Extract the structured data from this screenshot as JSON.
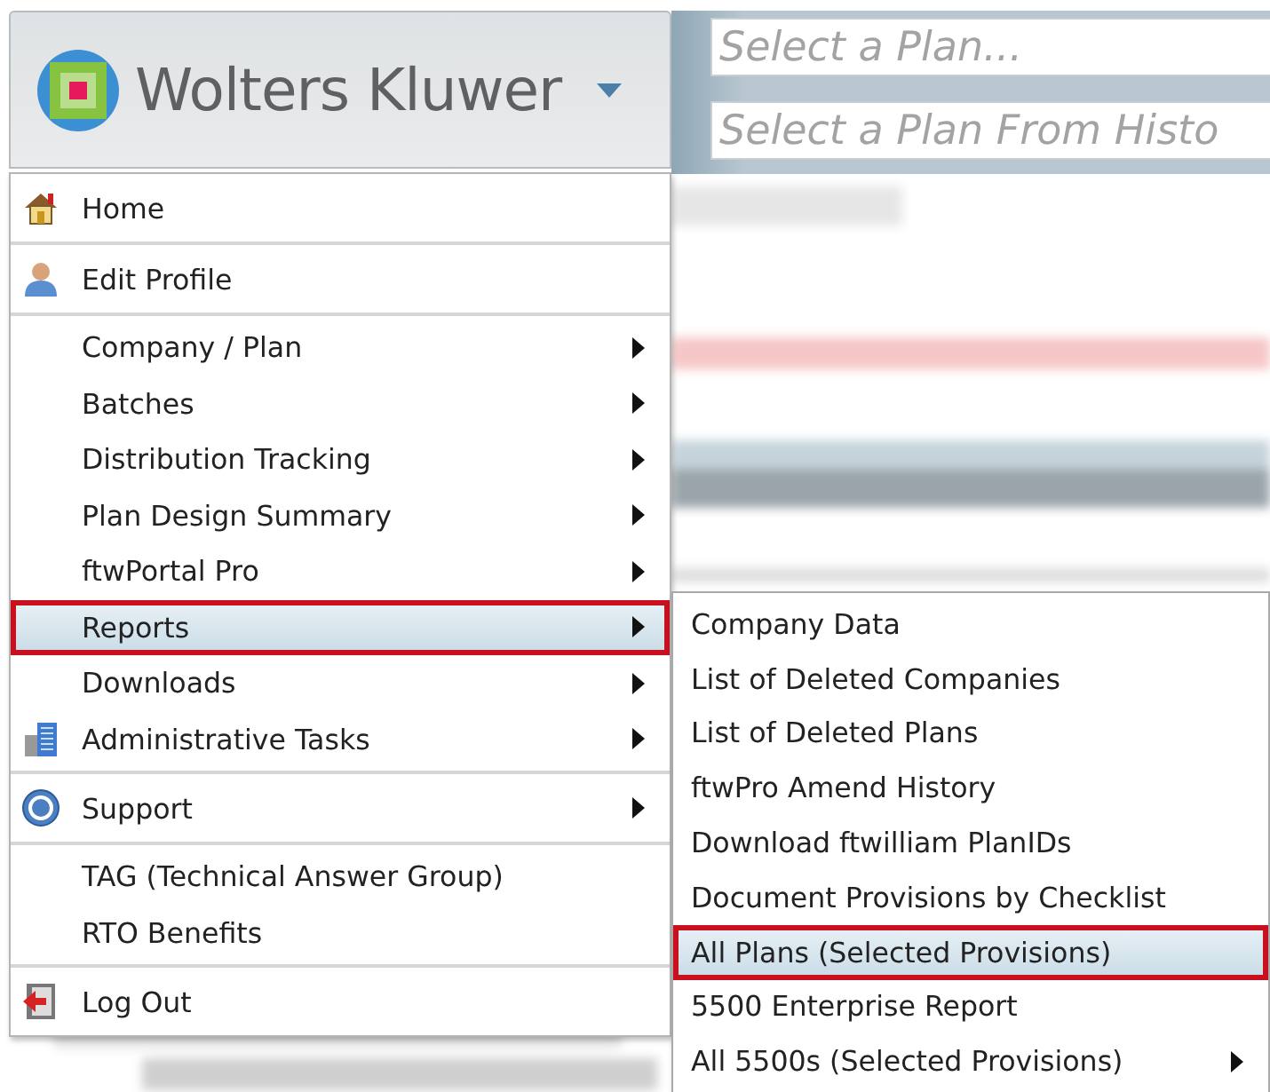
{
  "brand": {
    "name": "Wolters Kluwer"
  },
  "plan_fields": [
    {
      "placeholder": "Select a Plan..."
    },
    {
      "placeholder": "Select a Plan From Histo"
    }
  ],
  "main_menu": {
    "groups": [
      [
        {
          "label": "Home",
          "has_submenu": false,
          "selected": false
        }
      ],
      [
        {
          "label": "Edit Profile",
          "has_submenu": false,
          "selected": false
        }
      ],
      [
        {
          "label": "Company / Plan",
          "has_submenu": true,
          "selected": false
        },
        {
          "label": "Batches",
          "has_submenu": true,
          "selected": false
        },
        {
          "label": "Distribution Tracking",
          "has_submenu": true,
          "selected": false
        },
        {
          "label": "Plan Design Summary",
          "has_submenu": true,
          "selected": false
        },
        {
          "label": "ftwPortal Pro",
          "has_submenu": true,
          "selected": false
        },
        {
          "label": "Reports",
          "has_submenu": true,
          "selected": true
        },
        {
          "label": "Downloads",
          "has_submenu": true,
          "selected": false
        },
        {
          "label": "Administrative Tasks",
          "has_submenu": true,
          "selected": false
        }
      ],
      [
        {
          "label": "Support",
          "has_submenu": true,
          "selected": false
        }
      ],
      [
        {
          "label": "TAG (Technical Answer Group)",
          "has_submenu": false,
          "selected": false
        },
        {
          "label": "RTO Benefits",
          "has_submenu": false,
          "selected": false
        }
      ],
      [
        {
          "label": "Log Out",
          "has_submenu": false,
          "selected": false
        }
      ]
    ]
  },
  "reports_submenu": {
    "items": [
      {
        "label": "Company Data",
        "has_submenu": false,
        "selected": false
      },
      {
        "label": "List of Deleted Companies",
        "has_submenu": false,
        "selected": false
      },
      {
        "label": "List of Deleted Plans",
        "has_submenu": false,
        "selected": false
      },
      {
        "label": "ftwPro Amend History",
        "has_submenu": false,
        "selected": false
      },
      {
        "label": "Download ftwilliam PlanIDs",
        "has_submenu": false,
        "selected": false
      },
      {
        "label": "Document Provisions by Checklist",
        "has_submenu": false,
        "selected": false
      },
      {
        "label": "All Plans (Selected Provisions)",
        "has_submenu": false,
        "selected": true
      },
      {
        "label": "5500 Enterprise Report",
        "has_submenu": false,
        "selected": false
      },
      {
        "label": "All 5500s (Selected Provisions)",
        "has_submenu": true,
        "selected": false
      }
    ]
  }
}
